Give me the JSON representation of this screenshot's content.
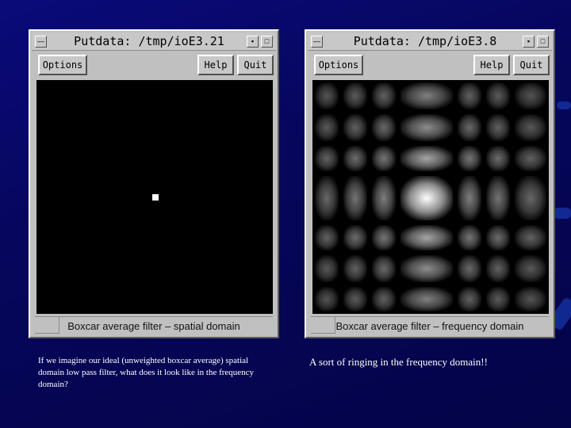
{
  "left_window": {
    "title": "Putdata: /tmp/ioE3.21",
    "buttons": {
      "options": "Options",
      "help": "Help",
      "quit": "Quit"
    },
    "status": "Boxcar average filter – spatial domain"
  },
  "right_window": {
    "title": "Putdata: /tmp/ioE3.8",
    "buttons": {
      "options": "Options",
      "help": "Help",
      "quit": "Quit"
    },
    "status": "Boxcar average filter – frequency domain"
  },
  "captions": {
    "left": "If we imagine our ideal (unweighted boxcar average) spatial domain low pass filter,  what does it look like in the frequency domain?",
    "right": "A sort of ringing in the frequency domain!!"
  }
}
